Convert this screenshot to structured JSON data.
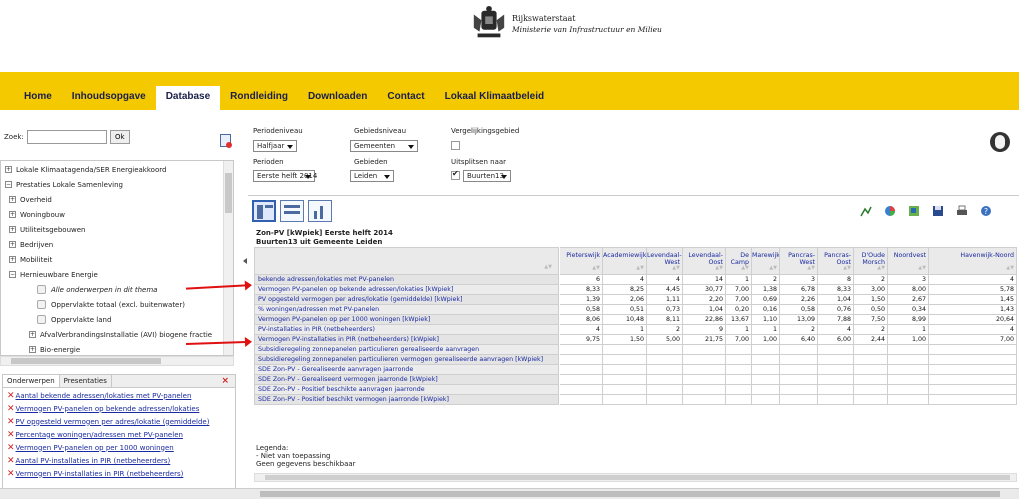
{
  "header": {
    "org": "Rijkswaterstaat",
    "ministry": "Ministerie van Infrastructuur en Milieu"
  },
  "nav": {
    "items": [
      {
        "label": "Home"
      },
      {
        "label": "Inhoudsopgave"
      },
      {
        "label": "Database",
        "active": true
      },
      {
        "label": "Rondleiding"
      },
      {
        "label": "Downloaden"
      },
      {
        "label": "Contact"
      },
      {
        "label": "Lokaal Klimaatbeleid"
      }
    ]
  },
  "search": {
    "label": "Zoek:",
    "value": "",
    "ok_label": "Ok"
  },
  "tree": {
    "items": [
      {
        "label": "Lokale Klimaatagenda/SER Energieakkoord",
        "expander": "+"
      },
      {
        "label": "Prestaties Lokale Samenleving",
        "expander": "−"
      },
      {
        "label": "Overheid",
        "expander": "+"
      },
      {
        "label": "Woningbouw",
        "expander": "+"
      },
      {
        "label": "Utiliteitsgebouwen",
        "expander": "+"
      },
      {
        "label": "Bedrijven",
        "expander": "+"
      },
      {
        "label": "Mobiliteit",
        "expander": "+"
      },
      {
        "label": "Hernieuwbare Energie",
        "expander": "−"
      },
      {
        "label": "Alle onderwerpen in dit thema",
        "checkbox": true
      },
      {
        "label": "Oppervlakte totaal (excl. buitenwater)",
        "checkbox": true
      },
      {
        "label": "Oppervlakte land",
        "checkbox": true
      },
      {
        "label": "AfvalVerbrandingsInstallatie (AVI) biogene fractie",
        "expander": "+"
      },
      {
        "label": "Bio-energie",
        "expander": "+"
      }
    ]
  },
  "panel_tabs": {
    "tabs": [
      "Onderwerpen",
      "Presentaties"
    ],
    "close": "×"
  },
  "subjects": [
    "Aantal bekende adressen/lokaties met PV-panelen",
    "Vermogen PV-panelen op bekende adressen/lokaties",
    "PV opgesteld vermogen per adres/lokatie (gemiddelde)",
    "Percentage woningen/adressen met PV-panelen",
    "Vermogen PV-panelen op per 1000 woningen",
    "Aantal PV-installaties in PIR (netbeheerders)",
    "Vermogen PV-installaties in PIR (netbeheerders)"
  ],
  "filters": {
    "periodeniveau": {
      "label": "Periodeniveau",
      "value": "Halfjaar"
    },
    "gebiedsniveau": {
      "label": "Gebiedsniveau",
      "value": "Gemeenten"
    },
    "vergelijkingsgebied": {
      "label": "Vergelijkingsgebied",
      "checked": false
    },
    "perioden": {
      "label": "Perioden",
      "value": "Eerste helft 2014"
    },
    "gebieden": {
      "label": "Gebieden",
      "value": "Leiden"
    },
    "uitsplitsen": {
      "label": "Uitsplitsen naar",
      "checked": true,
      "value": "Buurten13"
    }
  },
  "table": {
    "title_line1": "Zon-PV [kWpiek] Eerste helft 2014",
    "title_line2": "Buurten13 uit Gemeente Leiden",
    "columns": [
      "Pieterswijk",
      "Academiewijk",
      "Levendaal-West",
      "Levendaal-Oost",
      "De Camp",
      "Marewijk",
      "Pancras-West",
      "Pancras-Oost",
      "D'Oude Morsch",
      "Noordvest",
      "Havenwijk-Noord"
    ],
    "rows": [
      {
        "label": "bekende adressen/lokaties met PV-panelen",
        "values": [
          "6",
          "4",
          "4",
          "14",
          "1",
          "2",
          "3",
          "8",
          "2",
          "3",
          "4"
        ]
      },
      {
        "label": "Vermogen PV-panelen op bekende adressen/lokaties [kWpiek]",
        "values": [
          "8,33",
          "8,25",
          "4,45",
          "30,77",
          "7,00",
          "1,38",
          "6,78",
          "8,33",
          "3,00",
          "8,00",
          "5,78"
        ]
      },
      {
        "label": "PV opgesteld vermogen per adres/lokatie (gemiddelde) [kWpiek]",
        "values": [
          "1,39",
          "2,06",
          "1,11",
          "2,20",
          "7,00",
          "0,69",
          "2,26",
          "1,04",
          "1,50",
          "2,67",
          "1,45"
        ]
      },
      {
        "label": "% woningen/adressen met PV-panelen",
        "values": [
          "0,58",
          "0,51",
          "0,73",
          "1,04",
          "0,20",
          "0,16",
          "0,58",
          "0,76",
          "0,50",
          "0,34",
          "1,43"
        ]
      },
      {
        "label": "Vermogen PV-panelen op per 1000 woningen [kWpiek]",
        "values": [
          "8,06",
          "10,48",
          "8,11",
          "22,86",
          "13,67",
          "1,10",
          "13,09",
          "7,88",
          "7,50",
          "8,99",
          "20,64"
        ]
      },
      {
        "label": "PV-installaties in PIR (netbeheerders)",
        "values": [
          "4",
          "1",
          "2",
          "9",
          "1",
          "1",
          "2",
          "4",
          "2",
          "1",
          "4"
        ]
      },
      {
        "label": "Vermogen PV-installaties in PIR (netbeheerders) [kWpiek]",
        "values": [
          "9,75",
          "1,50",
          "5,00",
          "21,75",
          "7,00",
          "1,00",
          "6,40",
          "6,00",
          "2,44",
          "1,00",
          "7,00"
        ]
      },
      {
        "label": "Subsidieregeling zonnepanelen particulieren gerealiseerde aanvragen",
        "values": [
          "",
          "",
          "",
          "",
          "",
          "",
          "",
          "",
          "",
          "",
          ""
        ]
      },
      {
        "label": "Subsidieregeling zonnepanelen particulieren vermogen gerealiseerde aanvragen [kWpiek]",
        "values": [
          "",
          "",
          "",
          "",
          "",
          "",
          "",
          "",
          "",
          "",
          ""
        ]
      },
      {
        "label": "SDE Zon-PV - Gerealiseerde aanvragen jaarronde",
        "values": [
          "",
          "",
          "",
          "",
          "",
          "",
          "",
          "",
          "",
          "",
          ""
        ]
      },
      {
        "label": "SDE Zon-PV - Gerealiseerd vermogen jaarronde [kWpiek]",
        "values": [
          "",
          "",
          "",
          "",
          "",
          "",
          "",
          "",
          "",
          "",
          ""
        ]
      },
      {
        "label": "SDE Zon-PV - Positief beschikte aanvragen jaarronde",
        "values": [
          "",
          "",
          "",
          "",
          "",
          "",
          "",
          "",
          "",
          "",
          ""
        ]
      },
      {
        "label": "SDE Zon-PV - Positief beschikt vermogen jaarronde [kWpiek]",
        "values": [
          "",
          "",
          "",
          "",
          "",
          "",
          "",
          "",
          "",
          "",
          ""
        ]
      }
    ]
  },
  "legend": {
    "title": "Legenda:",
    "line1": "- Niet van toepassing",
    "line2": "Geen gegevens beschikbaar"
  },
  "colors": {
    "nav_bg": "#f5c900",
    "link": "#1a2aa0",
    "annotation_arrow": "#e01010"
  }
}
